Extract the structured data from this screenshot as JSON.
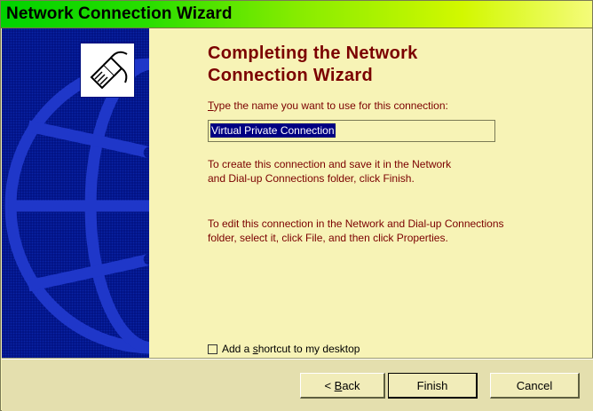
{
  "window": {
    "title": "Network Connection Wizard"
  },
  "banner": {
    "logo_icon": "network-plug-icon",
    "background_icon": "globe-icon"
  },
  "main": {
    "heading_line1": "Completing the Network",
    "heading_line2": "Connection Wizard",
    "name_label_accesskey": "T",
    "name_label_rest": "ype the name you want to use for this connection:",
    "name_value": "Virtual Private Connection",
    "para1_line1": "To create this connection and save it in the Network",
    "para1_line2": "and Dial-up Connections folder, click Finish.",
    "para2_line1": "To edit this connection in the Network and Dial-up Connections",
    "para2_line2": "folder, select it, click File, and then click Properties.",
    "shortcut_pre": "Add a ",
    "shortcut_accesskey": "s",
    "shortcut_post": "hortcut to my desktop",
    "shortcut_checked": false
  },
  "buttons": {
    "back_arrow": "<",
    "back_accesskey": "B",
    "back_rest": "ack",
    "finish": "Finish",
    "cancel": "Cancel"
  },
  "colors": {
    "background": "#f7f3b6",
    "text_accent": "#7b0000",
    "banner": "#00107f",
    "selection": "#000082"
  }
}
